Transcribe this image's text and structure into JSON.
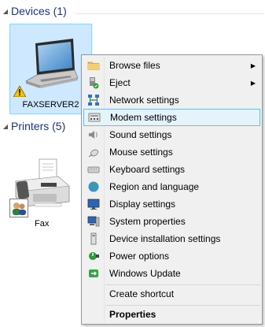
{
  "devices": {
    "title": "Devices (1)"
  },
  "printers": {
    "title": "Printers (5)"
  },
  "device": {
    "name": "FAXSERVER2"
  },
  "fax": {
    "name": "Fax"
  },
  "menu": {
    "items": [
      {
        "label": "Browse files",
        "icon": "folder-icon",
        "submenu": true
      },
      {
        "label": "Eject",
        "icon": "eject-icon",
        "submenu": true
      },
      {
        "label": "Network settings",
        "icon": "network-icon"
      },
      {
        "label": "Modem settings",
        "icon": "modem-icon",
        "highlighted": true
      },
      {
        "label": "Sound settings",
        "icon": "speaker-icon"
      },
      {
        "label": "Mouse settings",
        "icon": "mouse-icon"
      },
      {
        "label": "Keyboard settings",
        "icon": "keyboard-icon"
      },
      {
        "label": "Region and language",
        "icon": "globe-icon"
      },
      {
        "label": "Display settings",
        "icon": "display-icon"
      },
      {
        "label": "System properties",
        "icon": "system-icon"
      },
      {
        "label": "Device installation settings",
        "icon": "device-install-icon"
      },
      {
        "label": "Power options",
        "icon": "power-icon"
      },
      {
        "label": "Windows Update",
        "icon": "windows-update-icon"
      },
      {
        "label": "Create shortcut",
        "icon": ""
      },
      {
        "label": "Properties",
        "icon": "",
        "bold": true
      }
    ]
  },
  "colors": {
    "header": "#1e3287",
    "selection": "#cde8ff",
    "menu_highlight": "#e5f3fb"
  }
}
